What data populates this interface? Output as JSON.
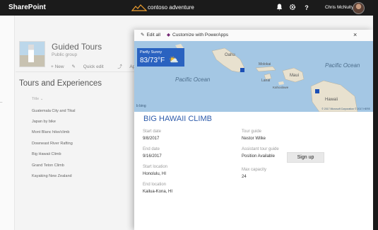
{
  "topbar": {
    "app_name": "SharePoint",
    "brand_text": "contoso adventure",
    "notification_icon": "bell-icon",
    "settings_icon": "gear-icon",
    "help_label": "?",
    "user_name": "Chris McNulty"
  },
  "site": {
    "title": "Guided Tours",
    "subtitle": "Public group",
    "commands": [
      "+ New",
      "Quick edit",
      "Approvals"
    ]
  },
  "list": {
    "title": "Tours and Experiences",
    "column_header": "Title",
    "items": [
      "Guatemala City and Tikal",
      "Japan by bike",
      "Mont Blanc hike/climb",
      "Downeast River Rafting",
      "Big Hawaii Climb",
      "Grand Teton Climb",
      "Kayaking New Zealand"
    ]
  },
  "panel": {
    "edit_all": "Edit all",
    "customize": "Customize with PowerApps",
    "close_label": "×",
    "weather": {
      "condition": "Partly Sunny",
      "temp": "83/73°F"
    },
    "map_labels": {
      "ocean_left": "Pacific Ocean",
      "ocean_right": "Pacific Ocean",
      "island_oahu": "Oahu",
      "island_maui": "Maui",
      "island_molokai": "Molokai",
      "island_lanai": "Lanai",
      "island_kahoolawe": "Kahoolawe",
      "island_hawaii": "Hawaii",
      "bing": "b bing",
      "copyright": "© 2017 Microsoft Corporation © 2017 HERE"
    },
    "tour_title": "BIG HAWAII CLIMB",
    "fields": {
      "start_date": {
        "label": "Start date",
        "value": "9/8/2017"
      },
      "end_date": {
        "label": "End date",
        "value": "9/16/2017"
      },
      "start_location": {
        "label": "Start location",
        "value": "Honolulu, HI"
      },
      "end_location": {
        "label": "End location",
        "value": "Kailua-Kona, HI"
      },
      "tour_guide": {
        "label": "Tour guide",
        "value": "Nestor Wilke"
      },
      "assistant_guide": {
        "label": "Assistant tour guide",
        "value": "Position Available"
      },
      "max_capacity": {
        "label": "Max capacity",
        "value": "24"
      }
    },
    "signup_label": "Sign up"
  }
}
